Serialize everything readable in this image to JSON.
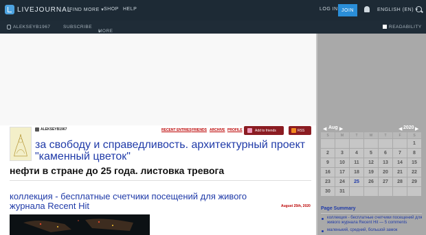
{
  "topbar": {
    "logo_text": "LIVEJOURNAL",
    "find_more": "FIND MORE",
    "shop": "SHOP",
    "help": "HELP",
    "login": "LOG IN",
    "join": "JOIN",
    "language": "ENGLISH (EN)",
    "find_more_arrow": "▾",
    "language_arrow": "▾"
  },
  "subbar": {
    "username": "ALEKSEYB1967",
    "subscribe": "SUBSCRIBE",
    "more": "MORE",
    "more_arrow": "▾",
    "readability": "READABILITY"
  },
  "header": {
    "username": "ALEKSEYB1967",
    "nav": {
      "recent": "RECENT ENTRIES",
      "friends": "FRIENDS",
      "archive": "ARCHIVE",
      "profile": "PROFILE"
    },
    "add_friends": "Add to friends",
    "rss": "RSS",
    "journal_title": "за свободу и справедливость. архитектурный проект \"каменный цветок\"",
    "journal_subtitle": "нефти в стране до 25 года. листовка тревога"
  },
  "entry": {
    "title": "коллекция - бесплатные счетчики посещений для живого журнала Recent Hit",
    "date": "August 25th, 2020"
  },
  "calendar": {
    "prev": "◀",
    "month": "Aug",
    "next": "▶",
    "year_prev": "◀",
    "year": "2020",
    "year_next": "▶",
    "dow": [
      "S",
      "M",
      "T",
      "W",
      "T",
      "F",
      "S"
    ],
    "weeks": [
      [
        "",
        "",
        "",
        "",
        "",
        "",
        "1"
      ],
      [
        "2",
        "3",
        "4",
        "5",
        "6",
        "7",
        "8"
      ],
      [
        "9",
        "10",
        "11",
        "12",
        "13",
        "14",
        "15"
      ],
      [
        "16",
        "17",
        "18",
        "19",
        "20",
        "21",
        "22"
      ],
      [
        "23",
        "24",
        "25",
        "26",
        "27",
        "28",
        "29"
      ],
      [
        "30",
        "31",
        "",
        "",
        "",
        "",
        ""
      ]
    ],
    "today": "25"
  },
  "page_summary": {
    "title": "Page Summary",
    "items": [
      "коллекция - бесплатные счетчики посещений для живого журнала Recent Hit — 5 comments",
      "маленький, средний, большой замок"
    ]
  },
  "colors": {
    "topbar": "#1d2a35",
    "accent": "#2a8ed8",
    "link": "#1f3aa8",
    "nav_red": "#bb0000",
    "button_red": "#8b1c22"
  }
}
